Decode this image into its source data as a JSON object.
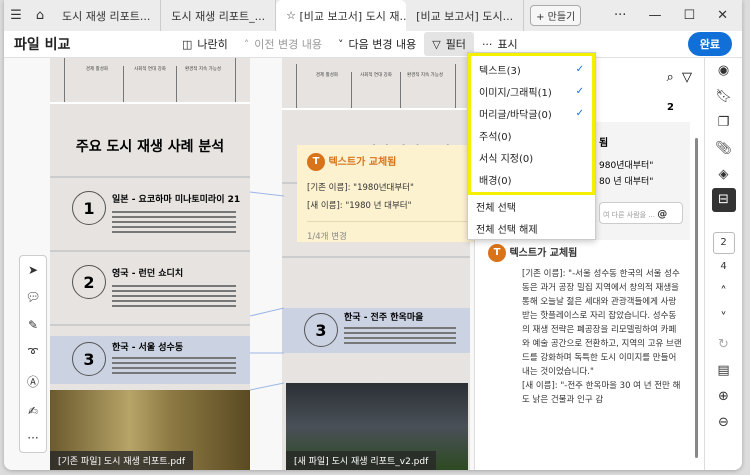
{
  "tabs": {
    "items": [
      "도시 재생 리포트...",
      "도시 재생 리포트_...",
      "[비교 보고서] 도시 재...",
      "[비교 보고서] 도시..."
    ],
    "new_tab": "+ 만들기"
  },
  "toolbar": {
    "title": "파일 비교",
    "side_by_side": "나란히",
    "prev_change": "이전 변경 내용",
    "next_change": "다음 변경 내용",
    "filter": "필터",
    "display": "표시",
    "done": "완료"
  },
  "filter_menu": {
    "items": [
      {
        "label": "텍스트(3)",
        "checked": true
      },
      {
        "label": "이미지/그래픽(1)",
        "checked": true
      },
      {
        "label": "머리글/바닥글(0)",
        "checked": true
      },
      {
        "label": "주석(0)",
        "checked": false
      },
      {
        "label": "서식 지정(0)",
        "checked": false
      },
      {
        "label": "배경(0)",
        "checked": false
      }
    ],
    "select_all": "전체 선택",
    "deselect_all": "전체 선택 해제"
  },
  "doc": {
    "cols": [
      "경제 활성화",
      "사회적 연대 강화",
      "환경적 지속 가능성"
    ],
    "heading": "주요 도시 재생 사례 분석",
    "sec1": "일본 - 요코하마 미나토미라이 21",
    "sec2": "영국 - 런던 쇼디치",
    "sec3_old": "한국 - 서울 성수동",
    "sec3_new": "한국 - 전주 한옥마을",
    "n1": "1",
    "n2": "2",
    "n3": "3",
    "old_caption": "[기존 파일] 도시 재생 리포트.pdf",
    "new_caption": "[새 파일] 도시 재생 리포트_v2.pdf"
  },
  "popup": {
    "title": "텍스트가 교체됨",
    "old": "[기존 이름]: \"1980년대부터\"",
    "new": "[새 이름]: \"1980 년 대부터\"",
    "count": "1/4개 변경"
  },
  "panel": {
    "page_no": "2",
    "card1_title_tail": "됨",
    "card1_old_tail": "980년대부터\"",
    "card1_new_tail": "80 년 대부터\"",
    "reply_placeholder": "여 다른 사람을 ...",
    "card2_title": "텍스트가 교체됨",
    "card2_text": "[기존 이름]: \"-서울 성수동 한국의 서울 성수동은 과거 공장 밀집 지역에서 창의적 재생을 통해 오늘날 젊은 세대와 관광객들에게 사랑받는 핫플레이스로 자리 잡았습니다. 성수동의 재생 전략은 폐공장을 리모델링하여 카페와 예술 공간으로 전환하고, 지역의 고유 브랜드를 강화하며 독특한 도시 이미지를 만들어내는 것이었습니다.\"",
    "card2_new": "[새 이름]: \"-전주 한옥마을 30 여 년 전만 해도 낡은 건물과 인구 감"
  },
  "rail": {
    "current_page": "2",
    "total_pages": "4"
  }
}
